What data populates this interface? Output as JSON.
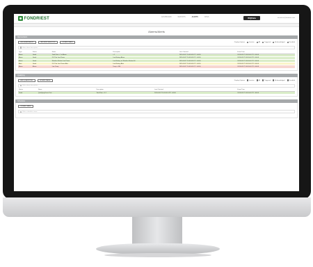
{
  "app": {
    "logo_text": "FONDRIEST",
    "product_badge": "WQData",
    "user_label": "alexisfiser@fondriest.com",
    "nav": [
      "Dashboard",
      "Reports",
      "Alerts",
      "Sites"
    ],
    "page_title": "Alarms/Alerts"
  },
  "display_options_label": "Display Options",
  "display_options": [
    {
      "label": "Inactive",
      "checked": true
    },
    {
      "label": "All",
      "checked": false
    },
    {
      "label": "Triggered",
      "checked": false
    },
    {
      "label": "Acknowledged",
      "checked": false
    },
    {
      "label": "Disabled",
      "checked": false
    }
  ],
  "filter_placeholder": "Filter alarm description",
  "sections": {
    "alarms": {
      "title": "Alarms/Alerts",
      "buttons": [
        "Add Alarm Alert",
        "Archive Selected",
        "Update Table"
      ],
      "columns": [
        "Type",
        "Status",
        "Name",
        "Description",
        "Last Checked",
        "Event Time"
      ],
      "rows": [
        {
          "type": "Alarm",
          "status": "Good",
          "name": "Total Rain > 1 in Alarm",
          "description": "> 1",
          "last": "2019-03-27 10:05:00 UTC -04:00",
          "event": "2019-03-27 10:05:00 UTC -04:00",
          "cls": "row-green"
        },
        {
          "type": "Alarm",
          "status": "Good",
          "name": "DO Port Low Power",
          "description": "Low Battery Alarm",
          "last": "2019-03-27 10:05:00 UTC -04:00",
          "event": "2019-03-27 10:05:00 UTC -04:00",
          "cls": "row-green"
        },
        {
          "type": "Alarm",
          "status": "Good",
          "name": "Weather Station Low Power",
          "description": "Low Battery on Weather Station 60",
          "last": "2019-03-27 10:05:00 UTC -04:00",
          "event": "2019-03-27 10:05:00 UTC -04:00",
          "cls": "row-green"
        },
        {
          "type": "Alert",
          "status": "Good",
          "name": "DO Port Low Power Alert",
          "description": "Low Battery Alert",
          "last": "2019-03-27 10:05:00 UTC -04:00",
          "event": "2019-03-27 10:05:00 UTC -04:00",
          "cls": "row-yellow"
        },
        {
          "type": "Alarm",
          "status": "Alarm",
          "name": "Low Temp",
          "description": "Temp < 400",
          "last": "2019-03-27 10:05:00 UTC -04:00",
          "event": "2019-03-27 10:05:00 UTC -04:00",
          "cls": "row-red"
        }
      ]
    },
    "qualifying": {
      "title": "Qualifying",
      "buttons": [
        "Add Qualifying",
        "Update Table"
      ],
      "columns": [
        "Status",
        "Name",
        "Description",
        "Last Checked",
        "Event Time"
      ],
      "rows": [
        {
          "status": "Good",
          "name": "Qualifying Event Test",
          "description": "Total Rain > 0.1",
          "last": "2019-03-27 10:05:00 UTC -04:00",
          "event": "2019-03-27 10:05:00 UTC -04:00",
          "cls": "row-green"
        }
      ]
    },
    "schedules": {
      "title": "Schedules",
      "buttons": [
        "Update Table"
      ],
      "filter_placeholder": "Filter schedules name"
    }
  }
}
